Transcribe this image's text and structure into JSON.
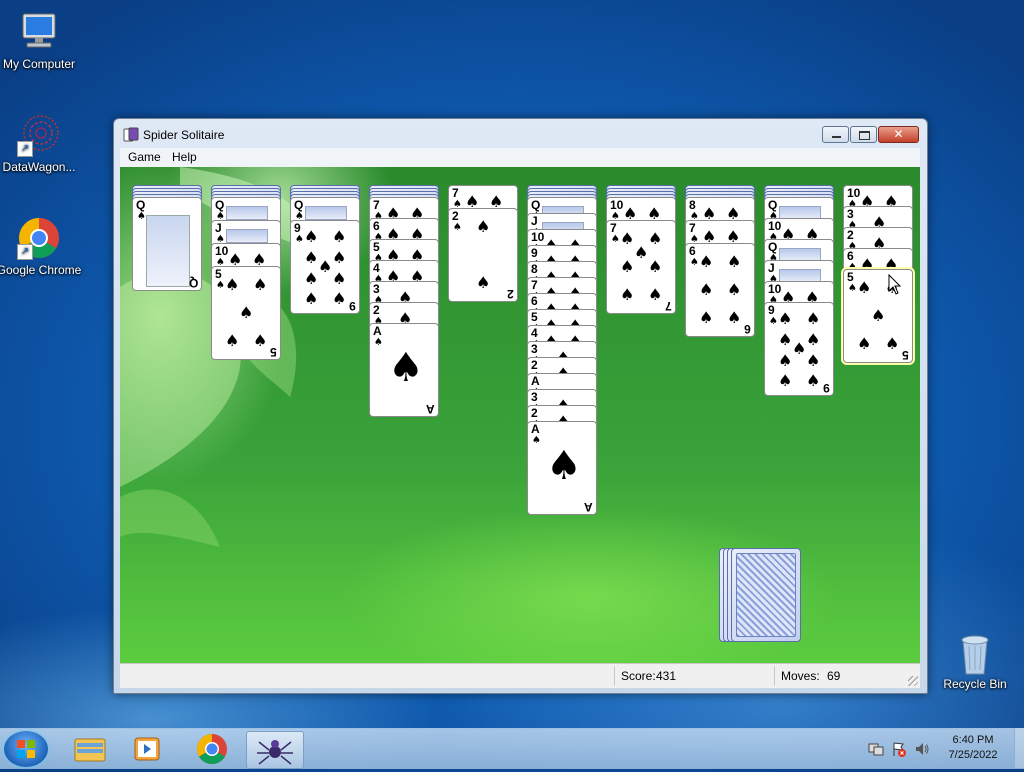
{
  "desktop": {
    "icons": [
      {
        "label": "My Computer",
        "icon": "computer-icon"
      },
      {
        "label": "DataWagon...",
        "icon": "datawagon-icon"
      },
      {
        "label": "Google Chrome",
        "icon": "chrome-icon"
      },
      {
        "label": "Recycle Bin",
        "icon": "recycle-bin-icon"
      }
    ]
  },
  "window": {
    "title": "Spider Solitaire",
    "menu": [
      "Game",
      "Help"
    ],
    "buttons": [
      "minimize",
      "maximize",
      "close"
    ]
  },
  "game": {
    "suit": "♠",
    "columns": [
      {
        "hidden": 4,
        "faceup": [
          "Q"
        ]
      },
      {
        "hidden": 4,
        "faceup": [
          "Q",
          "J",
          "10",
          "5"
        ]
      },
      {
        "hidden": 4,
        "faceup": [
          "Q",
          "9"
        ]
      },
      {
        "hidden": 4,
        "faceup": [
          "7",
          "6",
          "5",
          "4",
          "3",
          "2",
          "A"
        ]
      },
      {
        "hidden": 0,
        "faceup": [
          "7",
          "2"
        ]
      },
      {
        "hidden": 4,
        "faceup": [
          "Q",
          "J",
          "10",
          "9",
          "8",
          "7",
          "6",
          "5",
          "4",
          "3",
          "2",
          "A",
          "3",
          "2",
          "A"
        ]
      },
      {
        "hidden": 4,
        "faceup": [
          "10",
          "7"
        ]
      },
      {
        "hidden": 4,
        "faceup": [
          "8",
          "7",
          "6"
        ]
      },
      {
        "hidden": 4,
        "faceup": [
          "Q",
          "10",
          "Q",
          "J",
          "10",
          "9"
        ]
      },
      {
        "hidden": 0,
        "faceup": [
          "10",
          "3",
          "2",
          "6",
          "5"
        ]
      }
    ],
    "highlighted_card": {
      "column": 9,
      "rank": "5"
    },
    "stock_piles": 4
  },
  "status": {
    "score_label": "Score:",
    "score": "431",
    "moves_label": "Moves:",
    "moves": "69"
  },
  "taskbar": {
    "apps": [
      "windows-explorer-icon",
      "media-player-icon",
      "chrome-icon",
      "spider-solitaire-icon"
    ],
    "time": "6:40 PM",
    "date": "7/25/2022"
  }
}
